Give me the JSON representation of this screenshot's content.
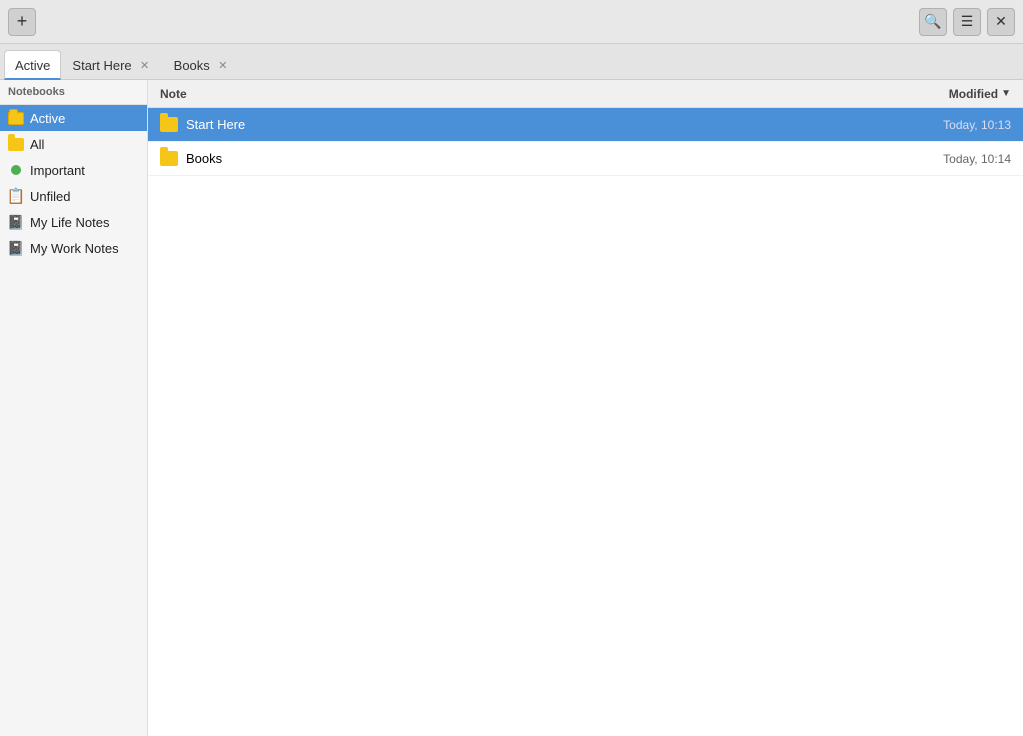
{
  "titlebar": {
    "add_label": "+",
    "search_icon": "🔍",
    "menu_icon": "☰",
    "close_icon": "✕"
  },
  "tabs": [
    {
      "id": "active",
      "label": "Active",
      "closable": false,
      "active": true
    },
    {
      "id": "start-here",
      "label": "Start Here",
      "closable": true,
      "active": false
    },
    {
      "id": "books",
      "label": "Books",
      "closable": true,
      "active": false
    }
  ],
  "sidebar": {
    "header": "Notebooks",
    "items": [
      {
        "id": "active",
        "label": "Active",
        "icon": "notebook-active",
        "selected": true
      },
      {
        "id": "all",
        "label": "All",
        "icon": "notebook",
        "selected": false
      },
      {
        "id": "important",
        "label": "Important",
        "icon": "dot-green",
        "selected": false
      },
      {
        "id": "unfiled",
        "label": "Unfiled",
        "icon": "unfiled",
        "selected": false
      },
      {
        "id": "my-life-notes",
        "label": "My Life Notes",
        "icon": "notes",
        "selected": false
      },
      {
        "id": "my-work-notes",
        "label": "My Work Notes",
        "icon": "notes",
        "selected": false
      }
    ]
  },
  "note_list": {
    "columns": {
      "note": "Note",
      "modified": "Modified"
    },
    "rows": [
      {
        "id": "start-here",
        "name": "Start Here",
        "modified": "Today, 10:13",
        "selected": true,
        "type": "folder"
      },
      {
        "id": "books",
        "name": "Books",
        "modified": "Today, 10:14",
        "selected": false,
        "type": "folder"
      }
    ]
  }
}
